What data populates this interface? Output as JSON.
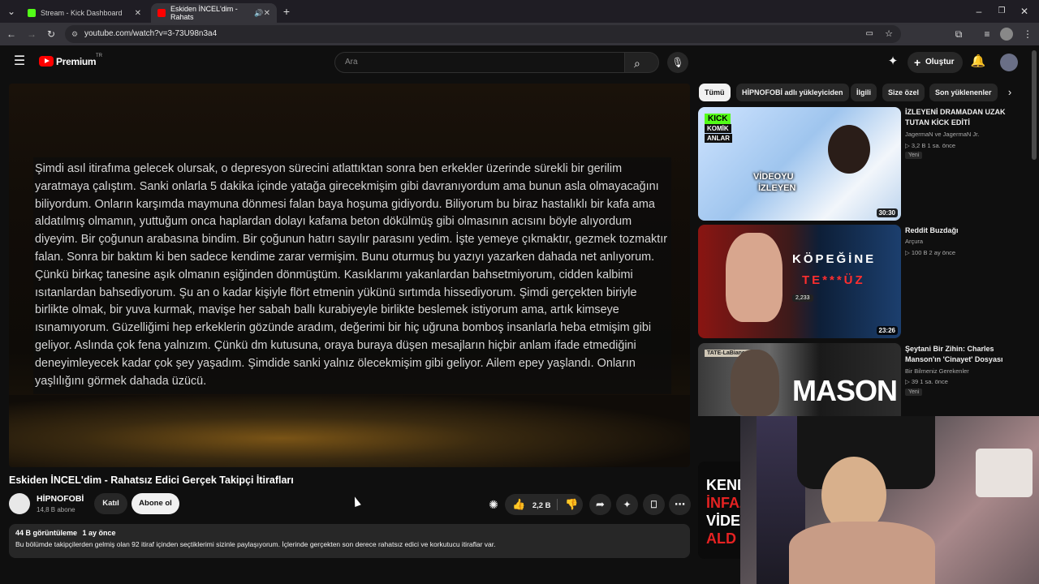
{
  "browser": {
    "tabs": [
      {
        "label": "Stream - Kick Dashboard",
        "favicon_color": "#53fc18"
      },
      {
        "label": "Eskiden İNCEL'dim - Rahats",
        "favicon_color": "#ff0000"
      }
    ],
    "url": "youtube.com/watch?v=3-73U98n3a4"
  },
  "youtube": {
    "logo": "Premium",
    "region": "TR",
    "search_placeholder": "Ara",
    "create_label": "Oluştur"
  },
  "video": {
    "quote": "Şimdi asıl itirafıma gelecek olursak, o depresyon sürecini atlattıktan sonra ben erkekler üzerinde sürekli bir gerilim yaratmaya çalıştım. Sanki onlarla 5 dakika içinde yatağa girecekmişim gibi davranıyordum ama bunun asla olmayacağını biliyordum. Onların karşımda maymuna dönmesi falan baya hoşuma gidiyordu. Biliyorum bu biraz hastalıklı bir kafa ama aldatılmış olmamın, yuttuğum onca haplardan dolayı kafama beton dökülmüş gibi olmasının acısını böyle alıyordum diyeyim. Bir çoğunun arabasına bindim. Bir çoğunun hatırı sayılır parasını yedim. İşte yemeye çıkmaktır, gezmek tozmaktır falan. Sonra bir baktım ki ben sadece kendime zarar vermişim. Bunu oturmuş bu yazıyı yazarken dahada net anlıyorum. Çünkü birkaç tanesine aşık olmanın eşiğinden dönmüştüm. Kasıklarımı yakanlardan bahsetmiyorum, cidden kalbimi ısıtanlardan bahsediyorum. Şu an o kadar kişiyle flört etmenin yükünü sırtımda hissediyorum. Şimdi gerçekten biriyle birlikte olmak, bir yuva kurmak, mavişe her sabah ballı kurabiyeyle birlikte beslemek istiyorum ama, artık kimseye ısınamıyorum. Güzelliğimi hep erkeklerin gözünde aradım, değerimi bir hiç uğruna bomboş insanlarla heba etmişim gibi geliyor. Aslında çok fena yalnızım. Çünkü dm kutusuna, oraya buraya düşen mesajların hiçbir anlam ifade etmediğini deneyimleyecek kadar çok şey yaşadım. Şimdide sanki yalnız ölecekmişim gibi geliyor. Ailem epey yaşlandı. Onların yaşlılığını görmek dahada üzücü.",
    "title": "Eskiden İNCEL'dim - Rahatsız Edici Gerçek Takipçi İtirafları",
    "channel": "HİPNOFOBİ",
    "subscribers": "14,8 B abone",
    "join_label": "Katıl",
    "subscribe_label": "Abone ol",
    "likes": "2,2 B",
    "views": "44 B görüntüleme",
    "age": "1 ay önce",
    "description": "Bu bölümde takipçilerden gelmiş olan 92 itiraf içinden seçtiklerimi sizinle paylaşıyorum. İçlerinde gerçekten son derece rahatsız edici ve korkutucu itiraflar var."
  },
  "chips": [
    "Tümü",
    "HİPNOFOBİ adlı yükleyiciden",
    "İlgili",
    "Size özel",
    "Son yüklenenler"
  ],
  "recommendations": [
    {
      "title": "İZLEYENİ DRAMADAN UZAK TUTAN KİCK EDİTİ",
      "channel": "JagermaN ve JagermaN Jr.",
      "stats": "3,2 B  1 sa. önce",
      "badge": "Yeni",
      "duration": "30:30",
      "thumb_text": [
        "KICK",
        "KOMİK",
        "ANLAR",
        "VİDEOYU",
        "İZLEYEN"
      ]
    },
    {
      "title": "Reddit Buzdağı",
      "channel": "Arçura",
      "stats": "100 B  2 ay önce",
      "duration": "23:26",
      "thumb_text": [
        "KÖPEĞİNE",
        "TE***ÜZ",
        "2,233"
      ]
    },
    {
      "title": "Şeytani Bir Zihin: Charles Manson'ın 'Cinayet' Dosyası",
      "channel": "Bir Bilmeniz Gerekenler",
      "stats": "39  1 sa. önce",
      "badge": "Yeni",
      "thumb_text": [
        "MASON",
        "TATE-LaBianca"
      ]
    },
    {
      "thumb_text": [
        "KEND",
        "İNFAZ",
        "VİDEO",
        "ALD"
      ]
    }
  ]
}
